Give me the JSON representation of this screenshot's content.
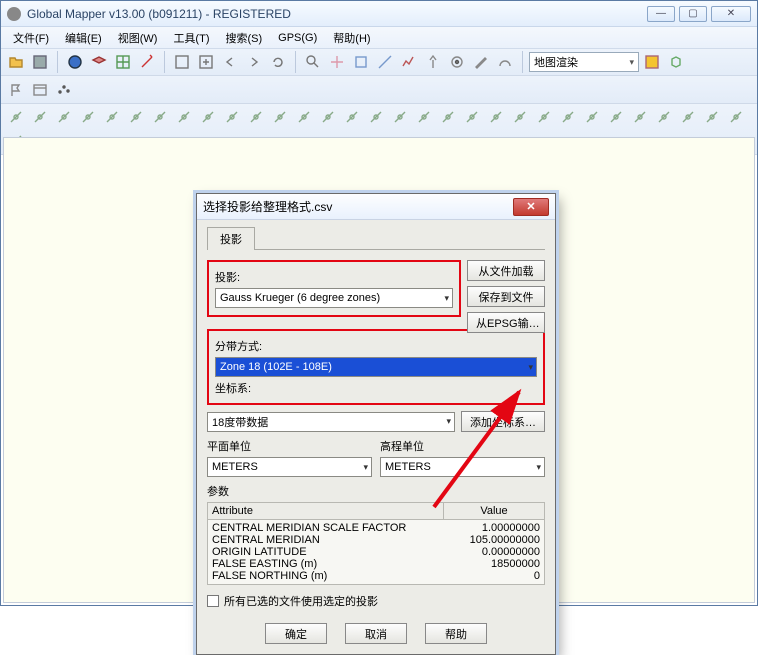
{
  "window": {
    "title": "Global Mapper v13.00 (b091211) - REGISTERED"
  },
  "menu": {
    "file": "文件(F)",
    "edit": "编辑(E)",
    "view": "视图(W)",
    "tools": "工具(T)",
    "search": "搜索(S)",
    "gps": "GPS(G)",
    "help": "帮助(H)"
  },
  "toolbar": {
    "map_render_label": "地图渲染"
  },
  "dialog": {
    "title": "选择投影给整理格式.csv",
    "tab_projection": "投影",
    "label_projection": "投影:",
    "projection_value": "Gauss Krueger (6 degree zones)",
    "btn_load_file": "从文件加载",
    "btn_save_file": "保存到文件",
    "btn_epsg": "从EPSG输…",
    "label_zone": "分带方式:",
    "zone_value": "Zone 18 (102E - 108E)",
    "label_datum": "坐标系:",
    "datum_value": "18度带数据",
    "btn_add_datum": "添加坐标系…",
    "label_planar_units": "平面单位",
    "planar_units_value": "METERS",
    "label_elev_units": "高程单位",
    "elev_units_value": "METERS",
    "label_params": "参数",
    "col_attribute": "Attribute",
    "col_value": "Value",
    "params": [
      {
        "name": "CENTRAL MERIDIAN SCALE FACTOR",
        "value": "1.00000000"
      },
      {
        "name": "CENTRAL MERIDIAN",
        "value": "105.00000000"
      },
      {
        "name": "ORIGIN LATITUDE",
        "value": "0.00000000"
      },
      {
        "name": "FALSE EASTING (m)",
        "value": "18500000"
      },
      {
        "name": "FALSE NORTHING (m)",
        "value": "0"
      }
    ],
    "chk_apply_all": "所有已选的文件使用选定的投影",
    "btn_ok": "确定",
    "btn_cancel": "取消",
    "btn_help": "帮助"
  }
}
